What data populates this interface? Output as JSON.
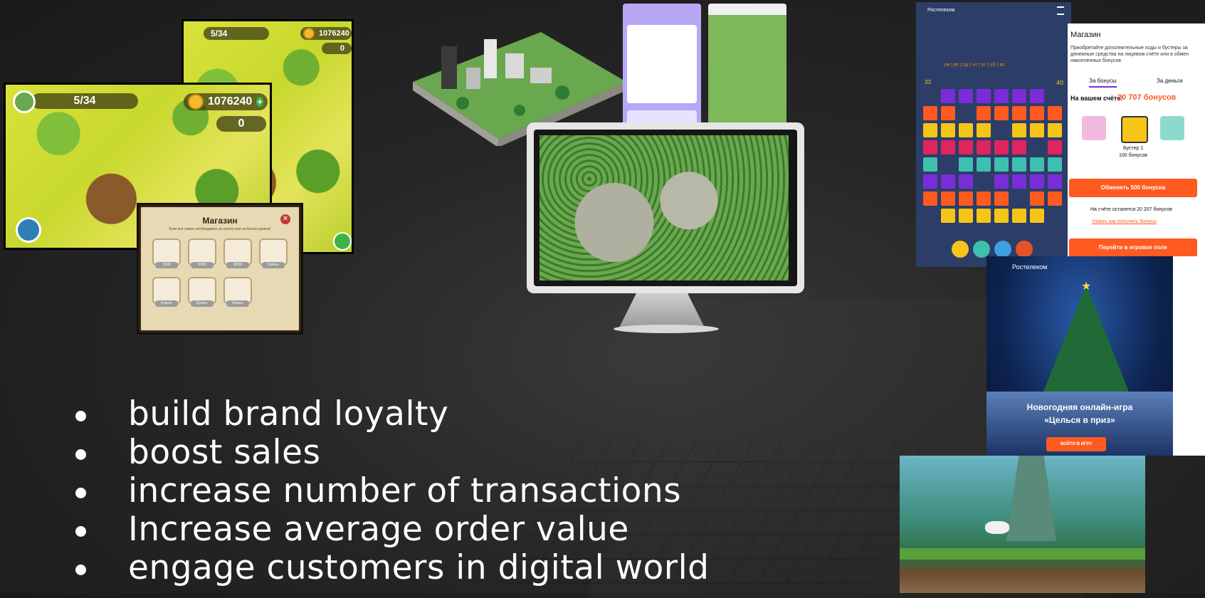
{
  "farm_back": {
    "level": "5/34",
    "coins": "1076240",
    "cash": "0"
  },
  "farm_front": {
    "level": "5/34",
    "coins": "1076240",
    "cash": "0"
  },
  "shop": {
    "title": "Магазин",
    "subtitle": "Купи всё самое необходимое за золото или за баллы уровня!",
    "items": [
      {
        "price": "1500"
      },
      {
        "price": "5000"
      },
      {
        "price": "8000"
      },
      {
        "price": "Купить"
      },
      {
        "price": "Купить"
      },
      {
        "price": "Купить"
      },
      {
        "price": "Купить"
      }
    ]
  },
  "rt_game": {
    "brand": "Ростелеком",
    "days": "пн | вт | ср | чт | пт | сб | вс",
    "score_left": "33",
    "score_right": "40"
  },
  "rt_shop": {
    "title": "Магазин",
    "desc": "Приобретайте дополнительные ходы и бустеры за денежные средства на лицевом счёте или в обмен накопленных бонусов",
    "tab_bonus": "За бонусы",
    "tab_money": "За деньги",
    "balance_label": "На вашем счёте:",
    "balance_value": "20 707 бонусов",
    "booster_name": "Бустер 1",
    "booster_price": "100 бонусов",
    "exchange_button": "Обменять 500 бонусов",
    "remaining": "На счёте останется 20 207 бонусов",
    "how_link": "Узнать как получить бонусы",
    "go_button": "Перейти в игровое поле"
  },
  "rt_banner": {
    "brand": "Ростелеком",
    "title_line1": "Новогодняя онлайн-игра",
    "title_line2": "«Целься в приз»",
    "button": "ВОЙТИ В ИГРУ"
  },
  "bullets": [
    "build brand loyalty",
    "boost sales",
    "increase number of transactions",
    "Increase average order value",
    "engage customers in digital world"
  ],
  "colors": {
    "accent_orange": "#ff5a1f",
    "rt_navy": "#2c3e67"
  }
}
